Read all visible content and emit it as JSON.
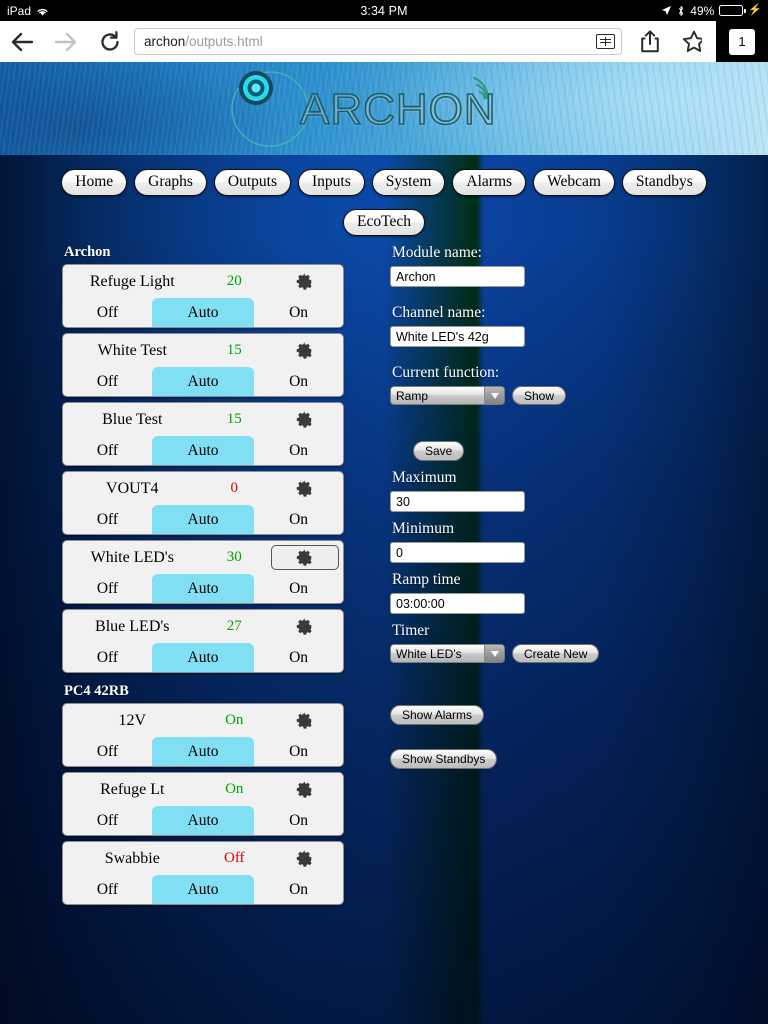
{
  "status_bar": {
    "device": "iPad",
    "wifi_icon": "wifi-icon",
    "time": "3:34 PM",
    "location_icon": "location-arrow-icon",
    "bluetooth_icon": "bluetooth-icon",
    "battery_percent": "49%",
    "battery_icon": "battery-icon",
    "charging_icon": "lightning-bolt-icon"
  },
  "browser": {
    "back_icon": "back-arrow-icon",
    "forward_icon": "forward-arrow-icon",
    "reload_icon": "reload-icon",
    "url_host": "archon",
    "url_path": "/outputs.html",
    "reader_icon": "reader-view-icon",
    "share_icon": "share-icon",
    "bookmark_icon": "star-icon",
    "tab_count": "1"
  },
  "header": {
    "logo_text": "ARCHON",
    "logo_mark_icon": "archon-circle-logo-icon",
    "signal_icon": "wifi-signal-arc-icon"
  },
  "nav": {
    "items": [
      {
        "label": "Home"
      },
      {
        "label": "Graphs"
      },
      {
        "label": "Outputs"
      },
      {
        "label": "Inputs"
      },
      {
        "label": "System"
      },
      {
        "label": "Alarms"
      },
      {
        "label": "Webcam"
      },
      {
        "label": "Standbys"
      }
    ],
    "second_row": [
      {
        "label": "EcoTech"
      }
    ]
  },
  "outputs": {
    "segment_labels": {
      "off": "Off",
      "auto": "Auto",
      "on": "On"
    },
    "gear_icon": "gear-icon",
    "groups": [
      {
        "title": "Archon",
        "rows": [
          {
            "name": "Refuge Light",
            "value": "20",
            "state": "on",
            "mode": "Auto",
            "selected": false
          },
          {
            "name": "White Test",
            "value": "15",
            "state": "on",
            "mode": "Auto",
            "selected": false
          },
          {
            "name": "Blue Test",
            "value": "15",
            "state": "on",
            "mode": "Auto",
            "selected": false
          },
          {
            "name": "VOUT4",
            "value": "0",
            "state": "off",
            "mode": "Auto",
            "selected": false
          },
          {
            "name": "White LED's",
            "value": "30",
            "state": "on",
            "mode": "Auto",
            "selected": true
          },
          {
            "name": "Blue LED's",
            "value": "27",
            "state": "on",
            "mode": "Auto",
            "selected": false
          }
        ]
      },
      {
        "title": "PC4 42RB",
        "rows": [
          {
            "name": "12V",
            "value": "On",
            "state": "on",
            "mode": "Auto",
            "selected": false
          },
          {
            "name": "Refuge Lt",
            "value": "On",
            "state": "on",
            "mode": "Auto",
            "selected": false
          },
          {
            "name": "Swabbie",
            "value": "Off",
            "state": "off",
            "mode": "Auto",
            "selected": false
          }
        ]
      }
    ]
  },
  "detail_panel": {
    "module_name_label": "Module name:",
    "module_name_value": "Archon",
    "channel_name_label": "Channel name:",
    "channel_name_value": "White LED's 42g",
    "current_function_label": "Current function:",
    "current_function_value": "Ramp",
    "show_button": "Show",
    "save_button": "Save",
    "maximum_label": "Maximum",
    "maximum_value": "30",
    "minimum_label": "Minimum",
    "minimum_value": "0",
    "ramp_time_label": "Ramp time",
    "ramp_time_value": "03:00:00",
    "timer_label": "Timer",
    "timer_value": "White LED's",
    "create_new_button": "Create New",
    "show_alarms_button": "Show Alarms",
    "show_standbys_button": "Show Standbys"
  },
  "colors": {
    "accent_cyan": "#80dff2",
    "value_on": "#00a400",
    "value_off": "#d80000",
    "page_blue": "#0a46a0"
  }
}
